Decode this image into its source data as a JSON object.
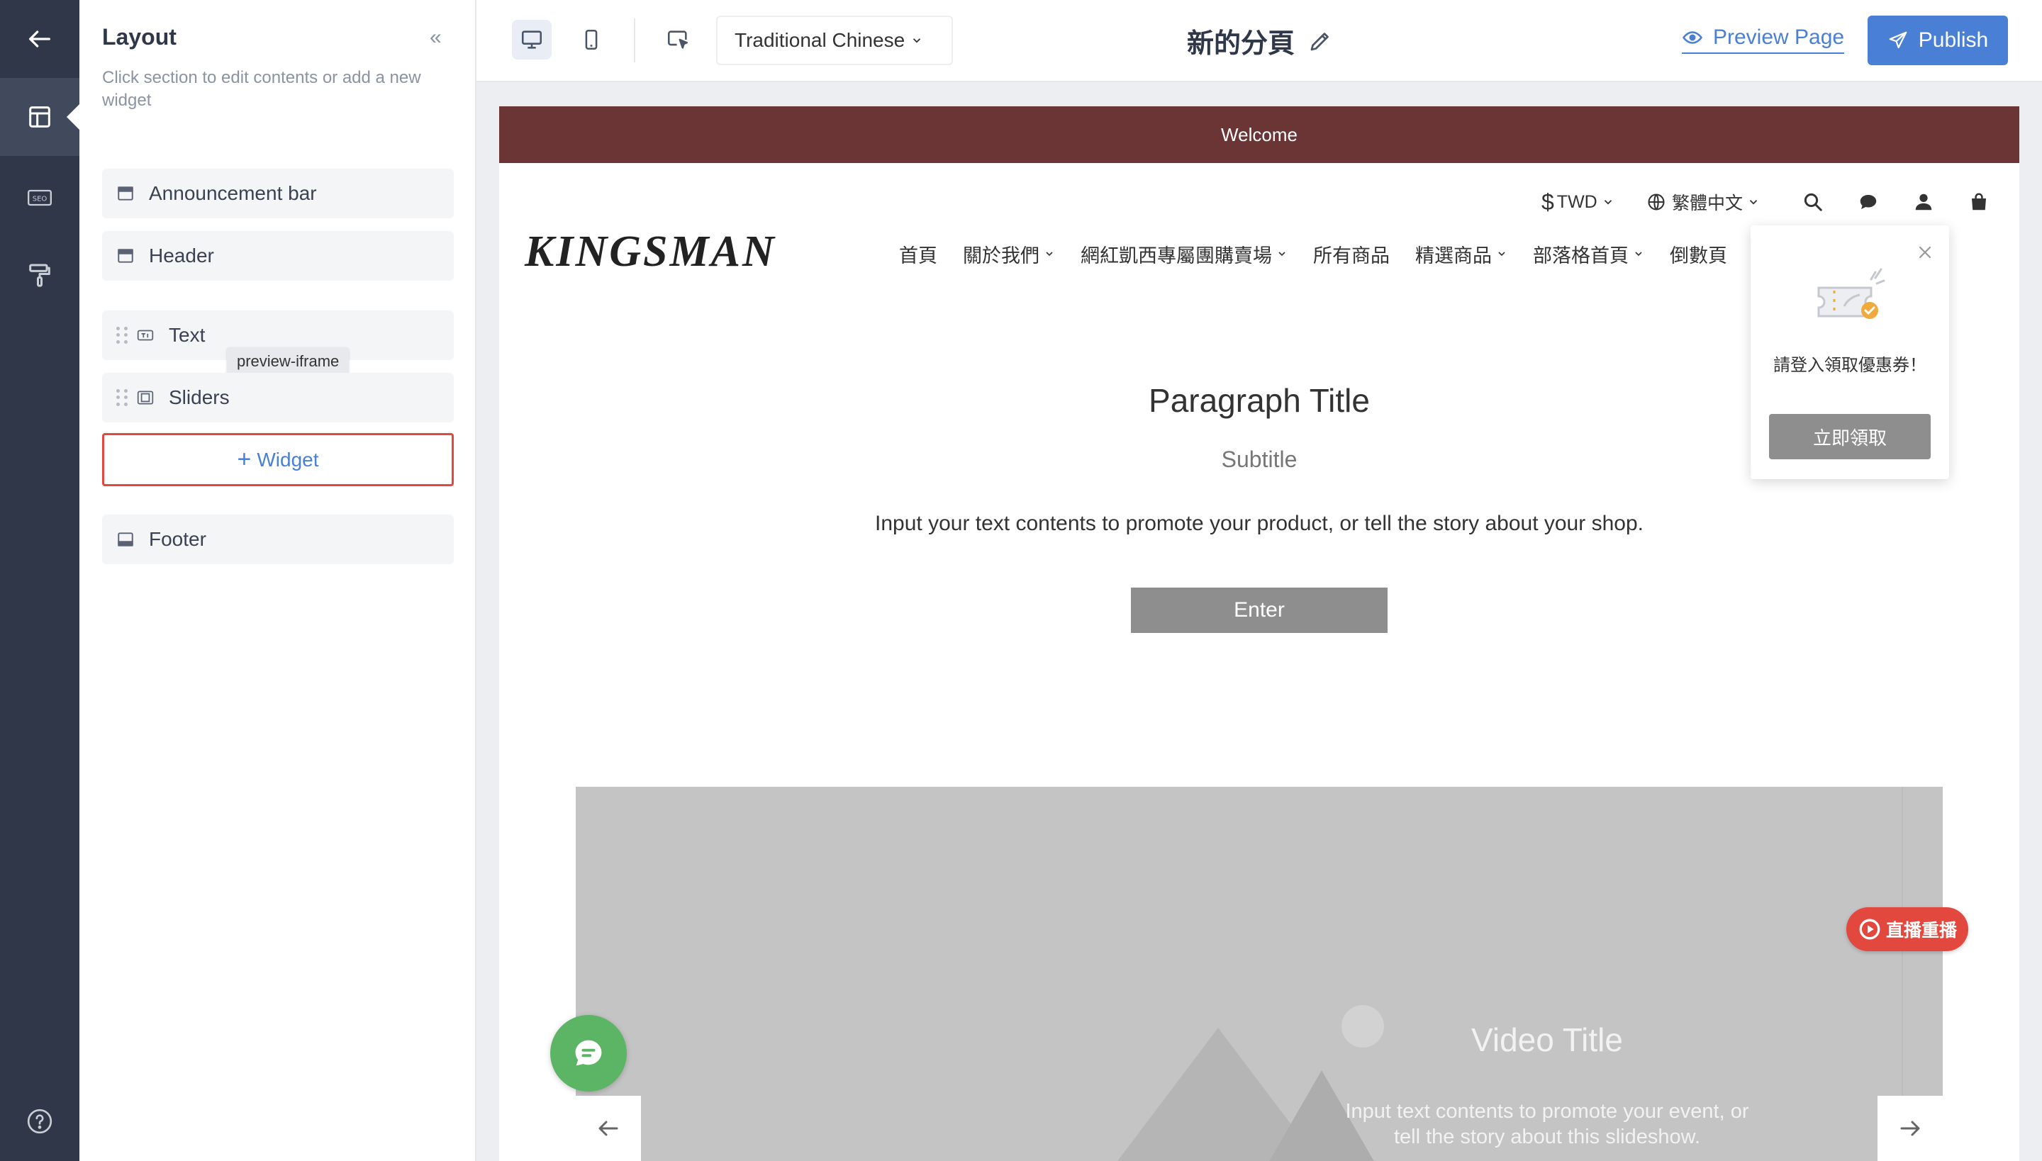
{
  "sidebar": {
    "title": "Layout",
    "collapse_glyph": "«",
    "description": "Click section to edit contents or add a new widget",
    "sections": [
      {
        "label": "Announcement bar",
        "icon": "section-icon"
      },
      {
        "label": "Header",
        "icon": "section-icon"
      },
      {
        "label": "Text",
        "icon": "text-widget-icon"
      },
      {
        "label": "Sliders",
        "icon": "slider-widget-icon"
      },
      {
        "label": "Footer",
        "icon": "footer-icon"
      }
    ],
    "tooltip": "preview-iframe",
    "add_widget_plus": "+",
    "add_widget_label": "Widget"
  },
  "rail": {
    "icons": [
      "back-arrow-icon",
      "layout-icon",
      "seo-icon",
      "paint-roller-icon",
      "help-icon"
    ],
    "seo_label": "SEO"
  },
  "toolbar": {
    "language": "Traditional Chinese",
    "page_title": "新的分頁",
    "preview_label": "Preview Page",
    "publish_label": "Publish"
  },
  "store": {
    "announcement": "Welcome",
    "currency_symbol": "$",
    "currency": "TWD",
    "language": "繁體中文",
    "logo": "KINGSMAN",
    "nav": [
      {
        "label": "首頁",
        "dropdown": false
      },
      {
        "label": "關於我們",
        "dropdown": true
      },
      {
        "label": "網紅凱西專屬團購賣場",
        "dropdown": true
      },
      {
        "label": "所有商品",
        "dropdown": false
      },
      {
        "label": "精選商品",
        "dropdown": true
      },
      {
        "label": "部落格首頁",
        "dropdown": true
      },
      {
        "label": "倒數頁",
        "dropdown": false
      }
    ],
    "coupon": {
      "text": "請登入領取優惠券！",
      "button": "立即領取"
    },
    "text_section": {
      "title": "Paragraph Title",
      "subtitle": "Subtitle",
      "body": "Input your text contents to promote your product, or tell the story about your shop.",
      "button": "Enter"
    },
    "slider": {
      "title": "Video Title",
      "description": "Input text contents to promote your event, or tell the story about this slideshow."
    },
    "live_badge": "直播重播"
  },
  "colors": {
    "accent": "#4a7fd6",
    "rail": "#2f3748",
    "announcement_bg": "#6b3535",
    "highlight": "#e2483d",
    "chat_green": "#5bb565"
  }
}
